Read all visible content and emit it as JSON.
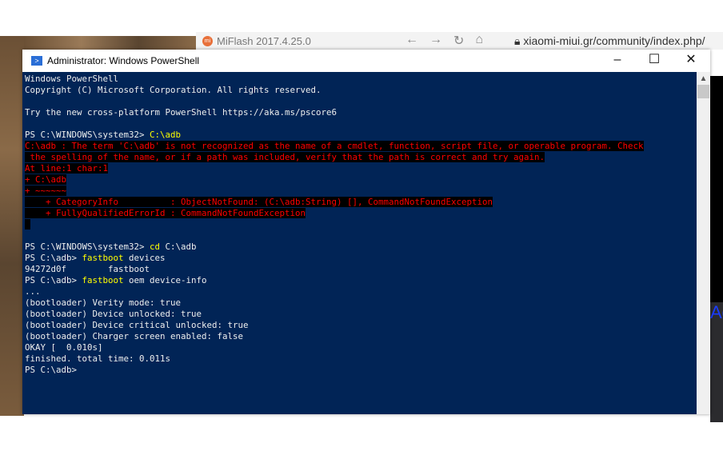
{
  "browser": {
    "tab_title": "MiFlash 2017.4.25.0",
    "url": "xiaomi-miui.gr/community/index.php/"
  },
  "window": {
    "title": "Administrator: Windows PowerShell",
    "minimize": "–",
    "maximize": "☐",
    "close": "✕"
  },
  "console": {
    "lines": [
      {
        "t": "Windows PowerShell"
      },
      {
        "t": "Copyright (C) Microsoft Corporation. All rights reserved."
      },
      {
        "t": ""
      },
      {
        "t": "Try the new cross-platform PowerShell https://aka.ms/pscore6"
      },
      {
        "t": ""
      },
      {
        "t": "PS C:\\WINDOWS\\system32> ",
        "c": "C:\\adb"
      },
      {
        "e": "C:\\adb : The term 'C:\\adb' is not recognized as the name of a cmdlet, function, script file, or operable program. Check"
      },
      {
        "e": " the spelling of the name, or if a path was included, verify that the path is correct and try again."
      },
      {
        "e": "At line:1 char:1"
      },
      {
        "e": "+ C:\\adb"
      },
      {
        "e": "+ ~~~~~~"
      },
      {
        "e": "    + CategoryInfo          : ObjectNotFound: (C:\\adb:String) [], CommandNotFoundException"
      },
      {
        "e": "    + FullyQualifiedErrorId : CommandNotFoundException"
      },
      {
        "e": " "
      },
      {
        "t": ""
      },
      {
        "t": "PS C:\\WINDOWS\\system32> ",
        "c": "cd",
        "r": " C:\\adb"
      },
      {
        "t": "PS C:\\adb> ",
        "c": "fastboot",
        "r": " devices"
      },
      {
        "t": "94272d0f        fastboot"
      },
      {
        "t": "PS C:\\adb> ",
        "c": "fastboot",
        "r": " oem device-info"
      },
      {
        "t": "..."
      },
      {
        "t": "(bootloader) Verity mode: true"
      },
      {
        "t": "(bootloader) Device unlocked: true"
      },
      {
        "t": "(bootloader) Device critical unlocked: true"
      },
      {
        "t": "(bootloader) Charger screen enabled: false"
      },
      {
        "t": "OKAY [  0.010s]"
      },
      {
        "t": "finished. total time: 0.011s"
      },
      {
        "t": "PS C:\\adb>"
      }
    ]
  },
  "right_strip": {
    "text": "Ad"
  }
}
